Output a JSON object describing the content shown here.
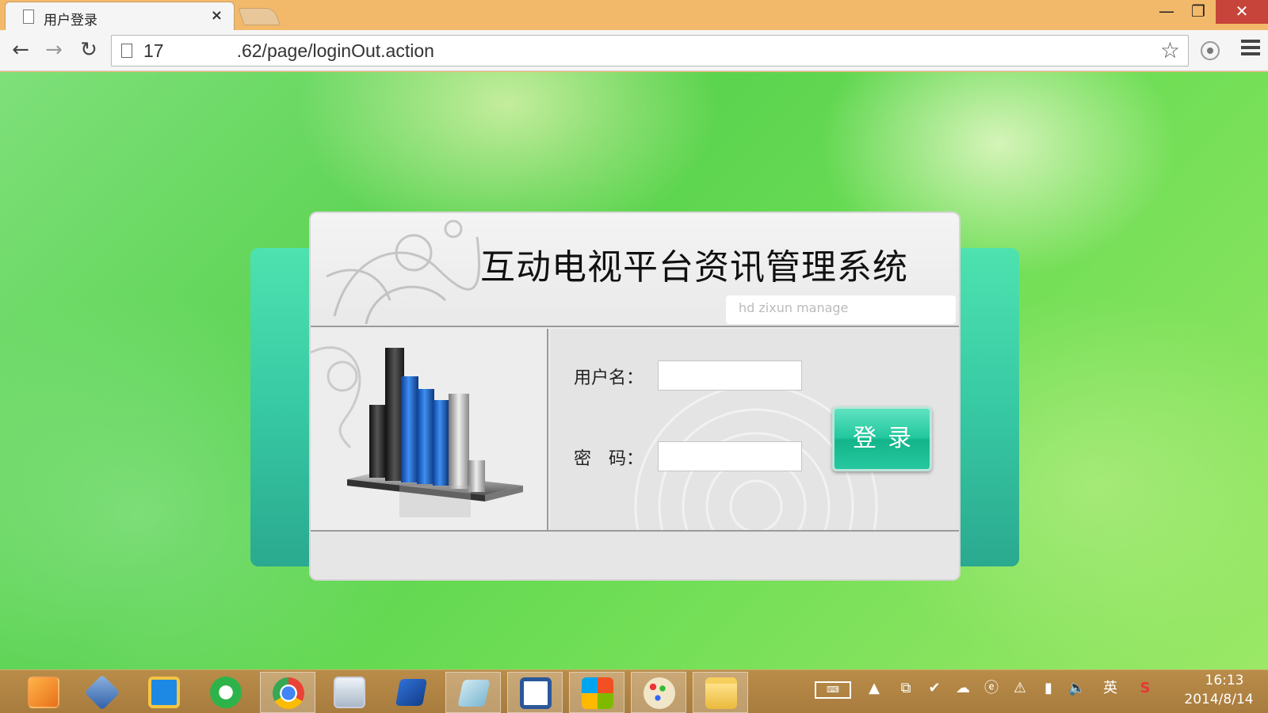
{
  "browser": {
    "tab_title": "用户登录",
    "tab_close": "×",
    "url": "17    .62/page/loginOut.action",
    "window_controls": {
      "minimize": "—",
      "maximize": "❐",
      "close": "✕"
    },
    "nav": {
      "back": "←",
      "forward": "→",
      "reload": "↻",
      "star": "☆"
    }
  },
  "login": {
    "system_title": "互动电视平台资讯管理系统",
    "subtitle": "hd zixun manage",
    "username_label": "用户名：",
    "password_label": "密　码：",
    "username_value": "",
    "password_value": "",
    "login_button": "登录"
  },
  "taskbar": {
    "apps": [
      "sublime-text",
      "virtualbox",
      "outlook",
      "ie-browser",
      "chrome",
      "resource-monitor",
      "remote-desktop",
      "notepad",
      "word",
      "windows-store",
      "paint",
      "file-explorer"
    ],
    "tray_icons": [
      "keyboard-icon",
      "show-hidden-icon",
      "network-share-icon",
      "safety-check-icon",
      "cloud-sync-icon",
      "ie-tray-icon",
      "network-warning-icon",
      "battery-icon",
      "volume-icon",
      "ime-icon",
      "sogou-icon"
    ],
    "ime": "英",
    "clock_time": "16:13",
    "clock_date": "2014/8/14"
  },
  "colors": {
    "titlebar": "#f3b96a",
    "teal_panel": "#37c9a3",
    "login_button": "#22c79d",
    "taskbar": "#b08444"
  }
}
